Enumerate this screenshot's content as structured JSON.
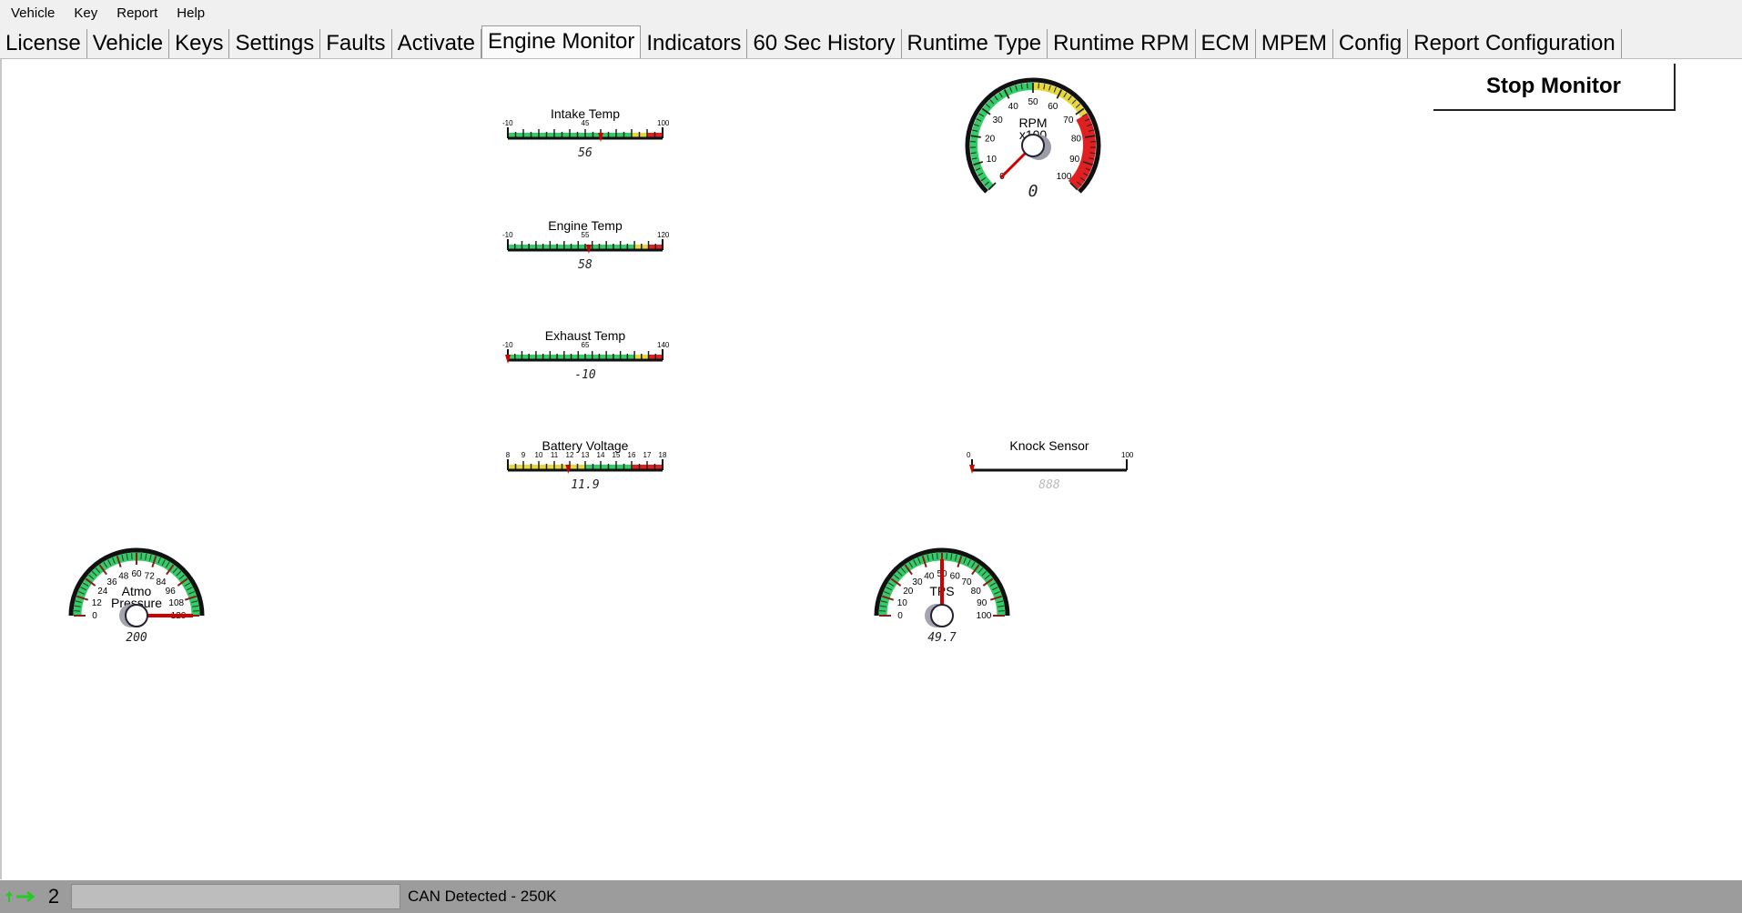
{
  "menu": [
    "Vehicle",
    "Key",
    "Report",
    "Help"
  ],
  "tabs": [
    {
      "label": "License",
      "active": false
    },
    {
      "label": "Vehicle",
      "active": false
    },
    {
      "label": "Keys",
      "active": false
    },
    {
      "label": "Settings",
      "active": false
    },
    {
      "label": "Faults",
      "active": false
    },
    {
      "label": "Activate",
      "active": false
    },
    {
      "label": "Engine Monitor",
      "active": true
    },
    {
      "label": "Indicators",
      "active": false
    },
    {
      "label": "60 Sec History",
      "active": false
    },
    {
      "label": "Runtime Type",
      "active": false
    },
    {
      "label": "Runtime RPM",
      "active": false
    },
    {
      "label": "ECM",
      "active": false
    },
    {
      "label": "MPEM",
      "active": false
    },
    {
      "label": "Config",
      "active": false
    },
    {
      "label": "Report Configuration",
      "active": false
    }
  ],
  "stop_button": "Stop Monitor",
  "colors": {
    "green": "#33cc66",
    "yellow": "#e6d83c",
    "red": "#e02020",
    "needle": "#d00000"
  },
  "linear_gauges": [
    {
      "id": "intake-temp",
      "title": "Intake Temp",
      "min": -10,
      "mid": 45,
      "max": 100,
      "min_label": "-10",
      "mid_label": "45",
      "max_label": "100",
      "value": 56,
      "display": "56",
      "zones": [
        "green",
        "green",
        "green",
        "green",
        "green",
        "green",
        "green",
        "green",
        "yellow",
        "red"
      ]
    },
    {
      "id": "engine-temp",
      "title": "Engine Temp",
      "min": -10,
      "mid": 55,
      "max": 120,
      "min_label": "-10",
      "mid_label": "55",
      "max_label": "120",
      "value": 58,
      "display": "58",
      "zones": [
        "green",
        "green",
        "green",
        "green",
        "green",
        "green",
        "green",
        "green",
        "green",
        "yellow",
        "red"
      ]
    },
    {
      "id": "exhaust-temp",
      "title": "Exhaust Temp",
      "min": -10,
      "mid": 65,
      "max": 140,
      "min_label": "-10",
      "mid_label": "65",
      "max_label": "140",
      "value": -10,
      "display": "-10",
      "zones": [
        "green",
        "green",
        "green",
        "green",
        "green",
        "green",
        "green",
        "green",
        "green",
        "yellow",
        "red"
      ]
    },
    {
      "id": "battery-voltage",
      "title": "Battery Voltage",
      "min": 8,
      "max": 18,
      "tick_labels": [
        "8",
        "9",
        "10",
        "11",
        "12",
        "13",
        "14",
        "15",
        "16",
        "17",
        "18"
      ],
      "value": 11.9,
      "display": "11.9",
      "zones": [
        "yellow",
        "yellow",
        "yellow",
        "yellow",
        "yellow",
        "green",
        "green",
        "green",
        "red",
        "red"
      ]
    },
    {
      "id": "knock-sensor",
      "title": "Knock Sensor",
      "min": 0,
      "max": 100,
      "min_label": "0",
      "max_label": "100",
      "value": 0,
      "display": "888",
      "zones": []
    }
  ],
  "rpm_gauge": {
    "title": "RPM",
    "subtitle": "x100",
    "tick_labels": [
      "0",
      "10",
      "20",
      "30",
      "40",
      "50",
      "60",
      "70",
      "80",
      "90",
      "100"
    ],
    "value": 0,
    "display": "0"
  },
  "atmo_gauge": {
    "title_line1": "Atmo",
    "title_line2": "Pressure",
    "tick_labels": [
      "0",
      "12",
      "24",
      "36",
      "48",
      "60",
      "72",
      "84",
      "96",
      "108",
      "120"
    ],
    "value": 120,
    "display": "200"
  },
  "tps_gauge": {
    "title": "TPS",
    "tick_labels": [
      "0",
      "10",
      "20",
      "30",
      "40",
      "50",
      "60",
      "70",
      "80",
      "90",
      "100"
    ],
    "value": 50,
    "display": "49.7"
  },
  "status": {
    "count": "2",
    "message": "CAN Detected - 250K"
  }
}
